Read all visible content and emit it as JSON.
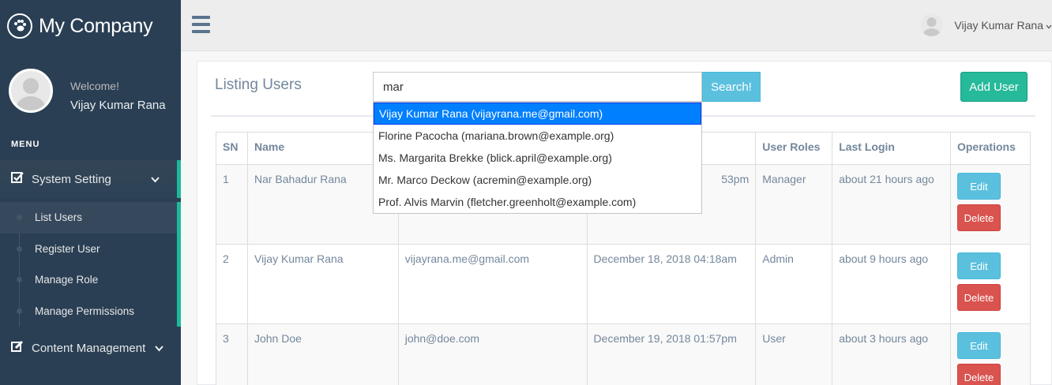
{
  "brand": {
    "title": "My Company",
    "icon": "paw-icon"
  },
  "profile": {
    "welcome": "Welcome!",
    "name": "Vijay Kumar Rana"
  },
  "menu_title": "MENU",
  "nav": {
    "system_setting": "System Setting",
    "content_management": "Content Management",
    "submenu": [
      "List Users",
      "Register User",
      "Manage Role",
      "Manage Permissions"
    ]
  },
  "topbar": {
    "user_name": "Vijay Kumar Rana"
  },
  "panel": {
    "title": "Listing Users",
    "search_value": "mar",
    "search_button": "Search!",
    "add_button": "Add User"
  },
  "autocomplete": [
    "Vijay Kumar Rana (vijayrana.me@gmail.com)",
    "Florine Pacocha (mariana.brown@example.org)",
    "Ms. Margarita Brekke (blick.april@example.org)",
    "Mr. Marco Deckow (acremin@example.org)",
    "Prof. Alvis Marvin (fletcher.greenholt@example.com)"
  ],
  "table": {
    "headers": [
      "SN",
      "Name",
      "",
      "",
      "User Roles",
      "Last Login",
      "Operations"
    ],
    "rows": [
      {
        "sn": "1",
        "name": "Nar Bahadur Rana",
        "email": "",
        "created": "53pm",
        "role": "Manager",
        "last_login": "about 21 hours ago"
      },
      {
        "sn": "2",
        "name": "Vijay Kumar Rana",
        "email": "vijayrana.me@gmail.com",
        "created": "December 18, 2018 04:18am",
        "role": "Admin",
        "last_login": "about 9 hours ago"
      },
      {
        "sn": "3",
        "name": "John Doe",
        "email": "john@doe.com",
        "created": "December 19, 2018 01:57pm",
        "role": "User",
        "last_login": "about 3 hours ago"
      }
    ],
    "edit_label": "Edit",
    "delete_label": "Delete"
  }
}
